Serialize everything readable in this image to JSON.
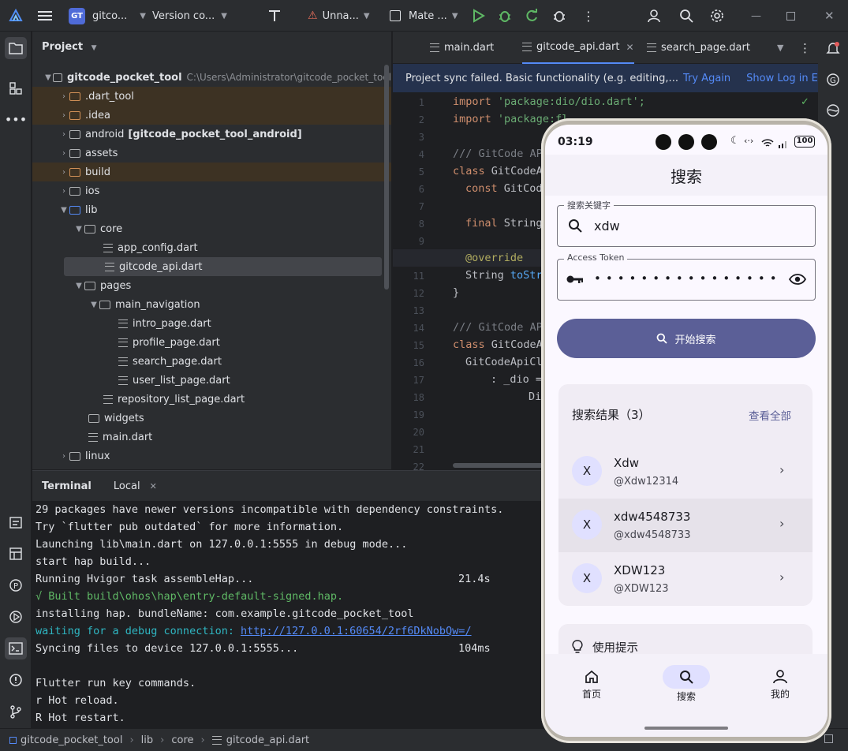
{
  "toolbar": {
    "project_badge": "GT",
    "project_name": "gitco...",
    "vcs": "Version co...",
    "run_config": "Unna...",
    "device": "Mate ..."
  },
  "project_panel": {
    "title": "Project",
    "root": {
      "name": "gitcode_pocket_tool",
      "path": "C:\\Users\\Administrator\\gitcode_pocket_tool"
    },
    "items": [
      {
        "label": ".dart_tool"
      },
      {
        "label": ".idea"
      },
      {
        "label": "android",
        "suffix": "[gitcode_pocket_tool_android]"
      },
      {
        "label": "assets"
      },
      {
        "label": "build"
      },
      {
        "label": "ios"
      },
      {
        "label": "lib"
      },
      {
        "label": "core"
      },
      {
        "label": "app_config.dart"
      },
      {
        "label": "gitcode_api.dart"
      },
      {
        "label": "pages"
      },
      {
        "label": "main_navigation"
      },
      {
        "label": "intro_page.dart"
      },
      {
        "label": "profile_page.dart"
      },
      {
        "label": "search_page.dart"
      },
      {
        "label": "user_list_page.dart"
      },
      {
        "label": "repository_list_page.dart"
      },
      {
        "label": "widgets"
      },
      {
        "label": "main.dart"
      },
      {
        "label": "linux"
      }
    ]
  },
  "editor": {
    "tabs": [
      {
        "label": "main.dart"
      },
      {
        "label": "gitcode_api.dart"
      },
      {
        "label": "search_page.dart"
      }
    ],
    "banner": {
      "message": "Project sync failed. Basic functionality (e.g. editing,...",
      "try_again": "Try Again",
      "show_log": "Show Log in Explorer"
    },
    "line_numbers": [
      "1",
      "2",
      "3",
      "4",
      "5",
      "6",
      "7",
      "8",
      "9",
      "10",
      "11",
      "12",
      "13",
      "14",
      "15",
      "16",
      "17",
      "18",
      "19",
      "20",
      "21",
      "22"
    ],
    "code": {
      "l1_kw": "import",
      "l1_str": "'package:dio/dio.dart';",
      "l2_kw": "import",
      "l2_str": "'package:fl",
      "l4": "/// GitCode AP",
      "l5_kw": "class",
      "l5_rest": "GitCodeA",
      "l6_kw": "const",
      "l6_rest": "GitCod",
      "l8_kw": "final",
      "l8_rest": "String",
      "l10": "@override",
      "l11_rest": "String",
      "l11_fn": "toStr",
      "l12": "}",
      "l14": "/// GitCode AP",
      "l15_kw": "class",
      "l15_rest": "GitCodeA",
      "l16": "GitCodeApiCl",
      "l17": ": _dio =",
      "l18": "Di"
    }
  },
  "terminal": {
    "title": "Terminal",
    "tab": "Local",
    "lines": [
      {
        "text": "29 packages have newer versions incompatible with dependency constraints."
      },
      {
        "text": "Try `flutter pub outdated` for more information."
      },
      {
        "text": "Launching lib\\main.dart on 127.0.0.1:5555 in debug mode..."
      },
      {
        "text": "start hap build..."
      },
      {
        "text": "Running Hvigor task assembleHap...",
        "right": "21.4s"
      },
      {
        "text": "√ Built build\\ohos\\hap\\entry-default-signed.hap."
      },
      {
        "text": "installing hap. bundleName: com.example.gitcode_pocket_tool"
      },
      {
        "text": "waiting for a debug connection:",
        "link": "http://127.0.0.1:60654/2rf6DkNobQw=/"
      },
      {
        "text": "Syncing files to device 127.0.0.1:5555...",
        "right": "104ms"
      },
      {
        "text": ""
      },
      {
        "text": "Flutter run key commands."
      },
      {
        "text": "r Hot reload."
      },
      {
        "text": "R Hot restart."
      }
    ]
  },
  "status_bar": {
    "crumbs": [
      "gitcode_pocket_tool",
      "lib",
      "core",
      "gitcode_api.dart"
    ]
  },
  "phone": {
    "time": "03:19",
    "battery": "100",
    "app_title": "搜索",
    "keyword_label": "搜索关键字",
    "keyword_value": "xdw",
    "token_label": "Access Token",
    "token_value": "••••••••••••••••",
    "search_button": "开始搜索",
    "results_title": "搜索结果（3）",
    "view_all": "查看全部",
    "results": [
      {
        "avatar": "X",
        "name": "Xdw",
        "handle": "@Xdw12314"
      },
      {
        "avatar": "X",
        "name": "xdw4548733",
        "handle": "@xdw4548733"
      },
      {
        "avatar": "X",
        "name": "XDW123",
        "handle": "@XDW123"
      }
    ],
    "tips_title": "使用提示",
    "nav": [
      {
        "label": "首页"
      },
      {
        "label": "搜索"
      },
      {
        "label": "我的"
      }
    ]
  },
  "colors": {
    "ide_bg": "#1e1f22",
    "panel_bg": "#2b2d30",
    "accent": "#548af7",
    "phone_primary": "#5b5f97",
    "phone_surface": "#fbf8ff"
  }
}
